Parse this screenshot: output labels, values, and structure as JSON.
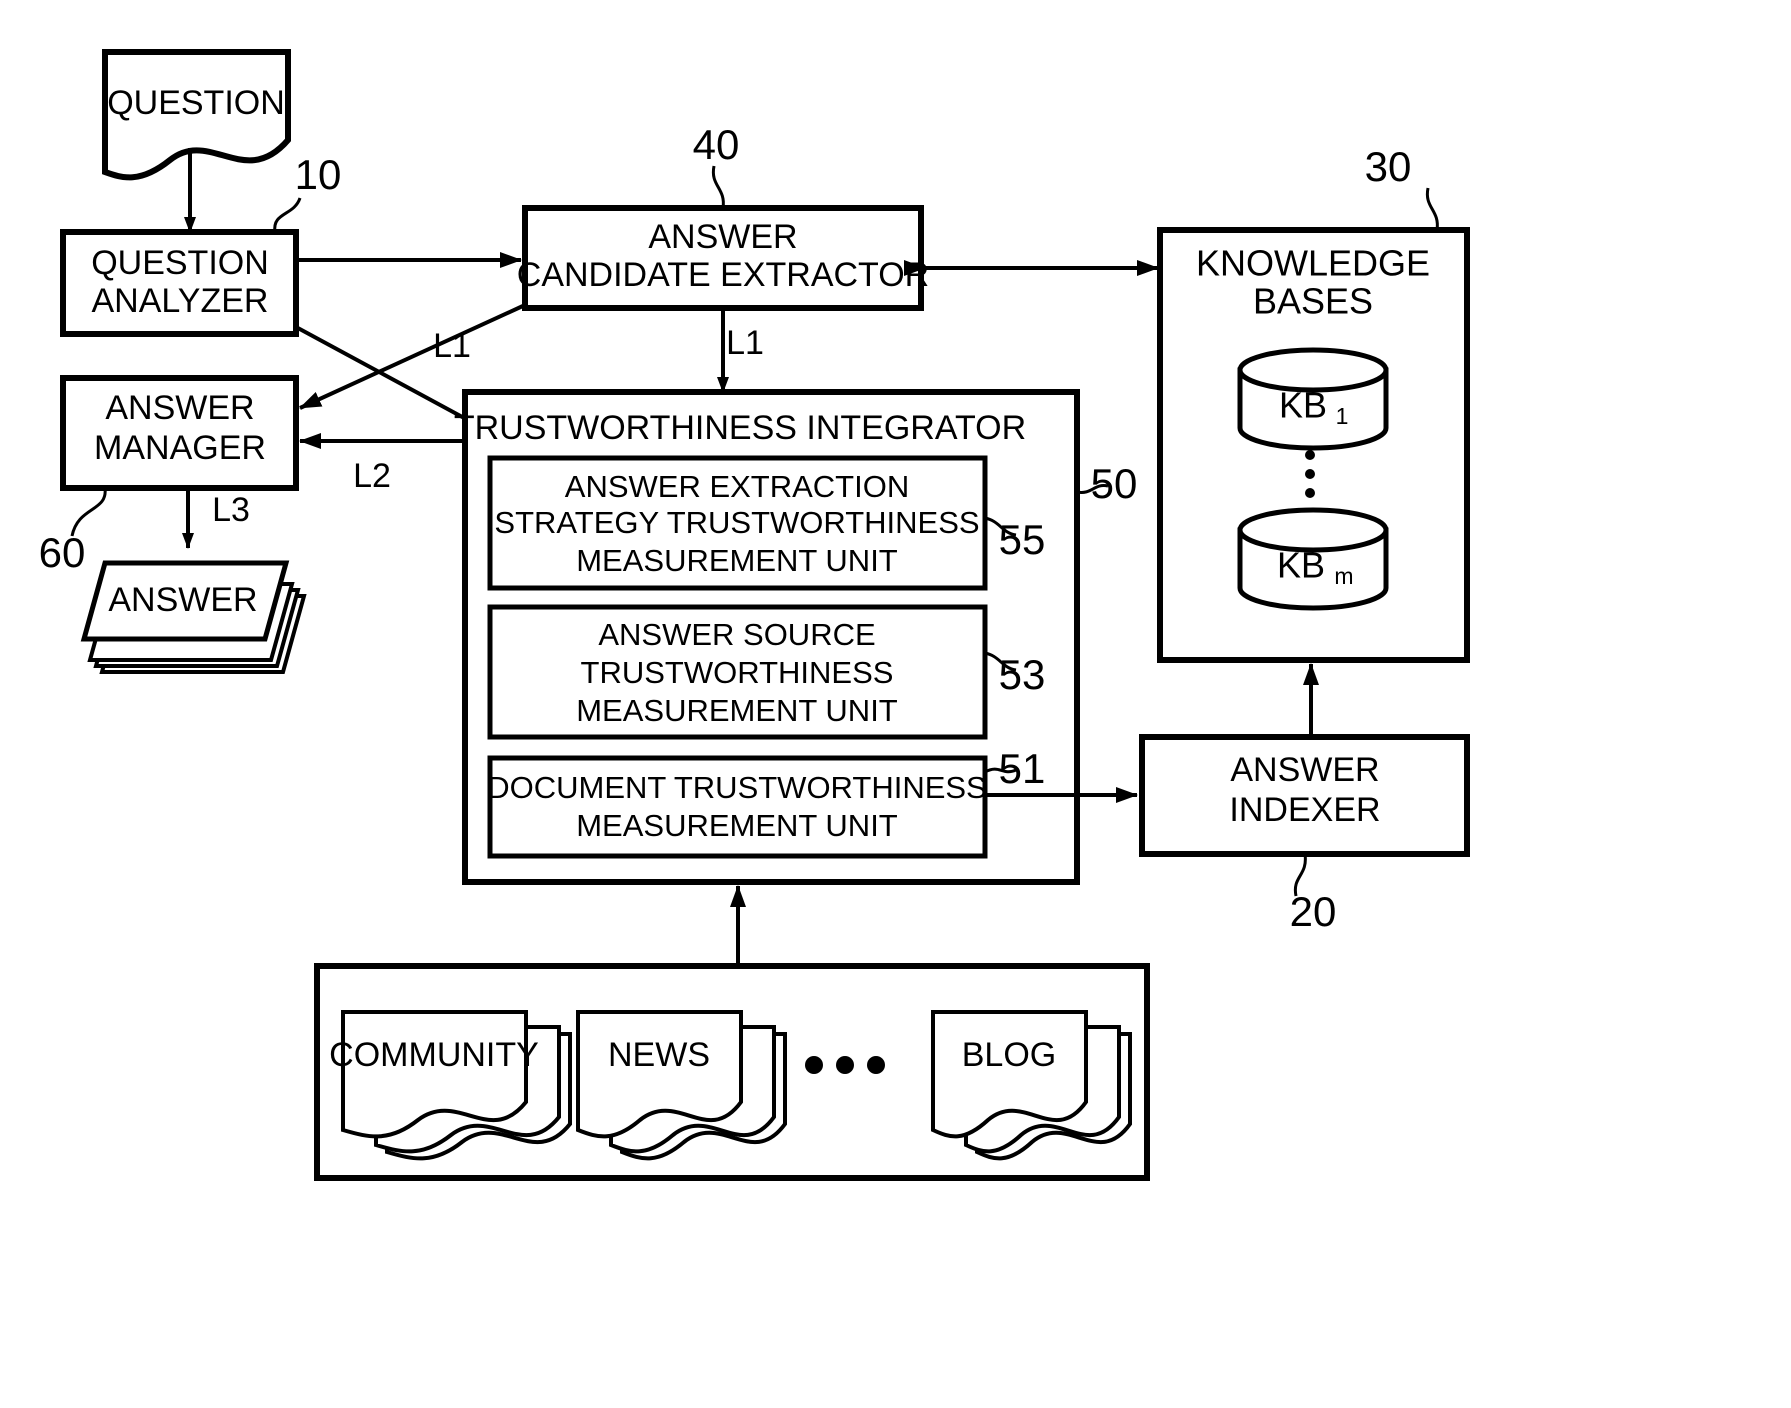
{
  "figure": {
    "title": "Question answering system block diagram",
    "stroke_color": "#000000",
    "background_color": "#ffffff"
  },
  "nodes": {
    "question_doc": {
      "label": "QUESTION",
      "ref": ""
    },
    "question_analyzer": {
      "line1": "QUESTION",
      "line2": "ANALYZER",
      "ref": "10"
    },
    "answer_manager": {
      "line1": "ANSWER",
      "line2": "MANAGER",
      "ref": "60"
    },
    "answer_doc": {
      "label": "ANSWER",
      "ref": ""
    },
    "answer_candidate_extractor": {
      "line1": "ANSWER",
      "line2": "CANDIDATE EXTRACTOR",
      "ref": "40"
    },
    "knowledge_bases": {
      "line1": "KNOWLEDGE",
      "line2": "BASES",
      "ref": "30",
      "kb_first": "KB",
      "kb_first_sub": "1",
      "kb_last": "KB",
      "kb_last_sub": "m",
      "ellipsis": "⋮"
    },
    "answer_indexer": {
      "line1": "ANSWER",
      "line2": "INDEXER",
      "ref": "20"
    },
    "trustworthiness_integrator": {
      "label": "TRUSTWORTHINESS INTEGRATOR",
      "ref": "50"
    },
    "unit_55": {
      "line1": "ANSWER EXTRACTION",
      "line2": "STRATEGY TRUSTWORTHINESS",
      "line3": "MEASUREMENT UNIT",
      "ref": "55"
    },
    "unit_53": {
      "line1": "ANSWER SOURCE",
      "line2": "TRUSTWORTHINESS",
      "line3": "MEASUREMENT UNIT",
      "ref": "53"
    },
    "unit_51": {
      "line1": "DOCUMENT TRUSTWORTHINESS",
      "line2": "MEASUREMENT UNIT",
      "ref": "51"
    },
    "sources": {
      "items": [
        {
          "label": "COMMUNITY"
        },
        {
          "label": "NEWS"
        },
        {
          "label": "BLOG"
        }
      ],
      "ellipsis": "..."
    }
  },
  "link_labels": {
    "l1_diagonal": "L1",
    "l1_vertical": "L1",
    "l2": "L2",
    "l3": "L3"
  }
}
